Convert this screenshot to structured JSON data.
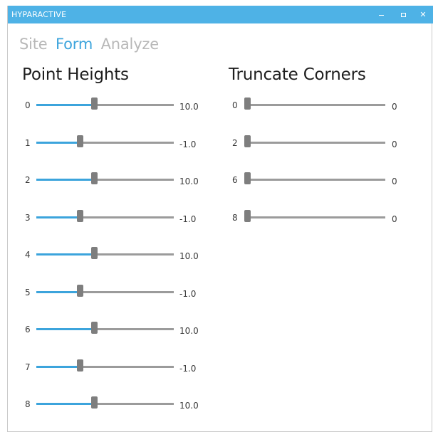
{
  "window": {
    "title": "HYPARACTIVE"
  },
  "nav": {
    "tabs": [
      {
        "label": "Site",
        "active": false
      },
      {
        "label": "Form",
        "active": true
      },
      {
        "label": "Analyze",
        "active": false
      }
    ]
  },
  "point_heights": {
    "title": "Point Heights",
    "rows": [
      {
        "index": "0",
        "value": "10.0",
        "position": 0.42
      },
      {
        "index": "1",
        "value": "-1.0",
        "position": 0.31
      },
      {
        "index": "2",
        "value": "10.0",
        "position": 0.42
      },
      {
        "index": "3",
        "value": "-1.0",
        "position": 0.31
      },
      {
        "index": "4",
        "value": "10.0",
        "position": 0.42
      },
      {
        "index": "5",
        "value": "-1.0",
        "position": 0.31
      },
      {
        "index": "6",
        "value": "10.0",
        "position": 0.42
      },
      {
        "index": "7",
        "value": "-1.0",
        "position": 0.31
      },
      {
        "index": "8",
        "value": "10.0",
        "position": 0.42
      }
    ]
  },
  "truncate_corners": {
    "title": "Truncate Corners",
    "rows": [
      {
        "index": "0",
        "value": "0",
        "position": 0
      },
      {
        "index": "2",
        "value": "0",
        "position": 0
      },
      {
        "index": "6",
        "value": "0",
        "position": 0
      },
      {
        "index": "8",
        "value": "0",
        "position": 0
      }
    ]
  },
  "colors": {
    "titlebar": "#4eb2e6",
    "accent": "#3ca4dc",
    "track": "#9b9b9b",
    "thumb": "#7e7e7e"
  }
}
